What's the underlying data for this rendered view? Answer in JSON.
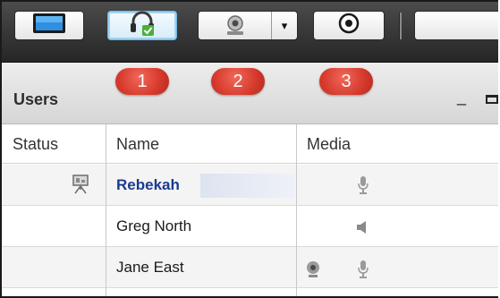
{
  "toolbar": {
    "buttons": [
      {
        "name": "share-screen-button",
        "icon": "monitor-icon"
      },
      {
        "name": "audio-button",
        "icon": "headset-icon"
      },
      {
        "name": "webcam-button",
        "icon": "webcam-icon"
      },
      {
        "name": "record-button",
        "icon": "record-icon"
      }
    ],
    "dropdown_caret": "▾"
  },
  "badges": [
    "1",
    "2",
    "3"
  ],
  "users_panel": {
    "title": "Users",
    "minimize": "_",
    "columns": {
      "status": "Status",
      "name": "Name",
      "media": "Media"
    },
    "rows": [
      {
        "name": "Rebekah",
        "status_icon": "presenter-icon",
        "media": [
          "microphone-icon"
        ],
        "bold": true
      },
      {
        "name": "Greg North",
        "status_icon": "",
        "media": [
          "speaker-icon"
        ],
        "bold": false
      },
      {
        "name": "Jane East",
        "status_icon": "",
        "media": [
          "webcam-icon",
          "microphone-icon"
        ],
        "bold": false
      }
    ]
  },
  "colors": {
    "badge": "#d63a2c",
    "toolbar": "#3a3a3a",
    "presenter_name": "#1a3b8f"
  }
}
